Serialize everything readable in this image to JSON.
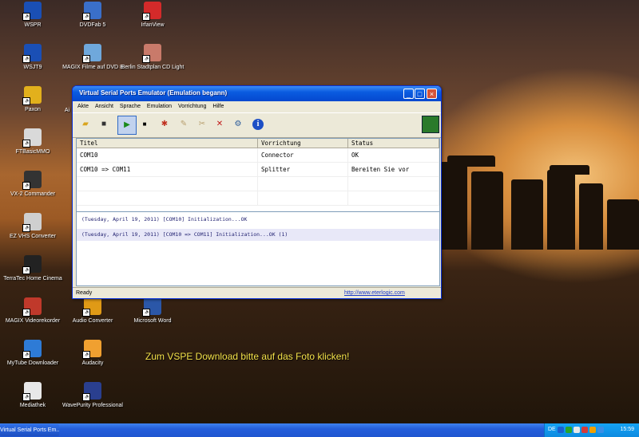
{
  "desktop": {
    "icons": [
      {
        "label": "WSPR",
        "color": "#1a4fb5"
      },
      {
        "label": "WSJT9",
        "color": "#1a4fb5"
      },
      {
        "label": "Paxon",
        "color": "#e2b01c"
      },
      {
        "label": "FTBasicMMO",
        "color": "#d9d9d9"
      },
      {
        "label": "VX-2 Commander",
        "color": "#333333"
      },
      {
        "label": "EZ VHS Converter",
        "color": "#cfcfcf"
      },
      {
        "label": "TerraTec Home Cinema",
        "color": "#222222"
      },
      {
        "label": "MAGIX Videorekorder",
        "color": "#c0392b"
      },
      {
        "label": "MyTube Downloader",
        "color": "#2e7bd6"
      },
      {
        "label": "Mediathek",
        "color": "#e8e8e8"
      },
      {
        "label": "DVDFab 5",
        "color": "#3a6fc9"
      },
      {
        "label": "MAGIX Filme auf DVD 8",
        "color": "#6fa8dc"
      },
      {
        "label": "Audio Converter",
        "color": "#e09a16"
      },
      {
        "label": "Audacity",
        "color": "#f0a030"
      },
      {
        "label": "WavePurity Professional",
        "color": "#2a3f8f"
      },
      {
        "label": "IrfanView",
        "color": "#d42a2a"
      },
      {
        "label": "Berlin Stadtplan CD Light",
        "color": "#c97a6a"
      },
      {
        "label": "Microsoft Word",
        "color": "#2b57a8"
      }
    ],
    "partial_label": "Ai",
    "promo_text": "Zum VSPE Download bitte auf das Foto klicken!"
  },
  "window": {
    "title": "Virtual Serial Ports Emulator (Emulation begann)",
    "menu": [
      "Akte",
      "Ansicht",
      "Sprache",
      "Emulation",
      "Vorrichtung",
      "Hilfe"
    ],
    "toolbar_icons": [
      "open-folder-icon",
      "save-icon",
      "play-icon",
      "stop-icon",
      "add-device-icon",
      "edit-device-icon",
      "remove-device-icon",
      "delete-device-icon",
      "settings-icon",
      "info-icon",
      "device-card-icon"
    ],
    "table": {
      "headers": [
        "Titel",
        "Vorrichtung",
        "Status"
      ],
      "rows": [
        [
          "COM10",
          "Connector",
          "OK"
        ],
        [
          "COM10 => COM11",
          "Splitter",
          "Bereiten Sie vor"
        ]
      ]
    },
    "log": [
      "(Tuesday, April 19, 2011) [COM10] Initialization...OK",
      "(Tuesday, April 19, 2011) [COM10 => COM11] Initialization...OK (1)"
    ],
    "status_text": "Ready",
    "link": "http://www.eterlogic.com"
  },
  "taskbar": {
    "task": "Virtual Serial Ports Em...",
    "lang": "DE",
    "clock": "15:59",
    "tray_colors": [
      "#1c5fd0",
      "#2aa52a",
      "#e8e8e8",
      "#d43a3a",
      "#f0a000",
      "#3a8ee6"
    ]
  }
}
